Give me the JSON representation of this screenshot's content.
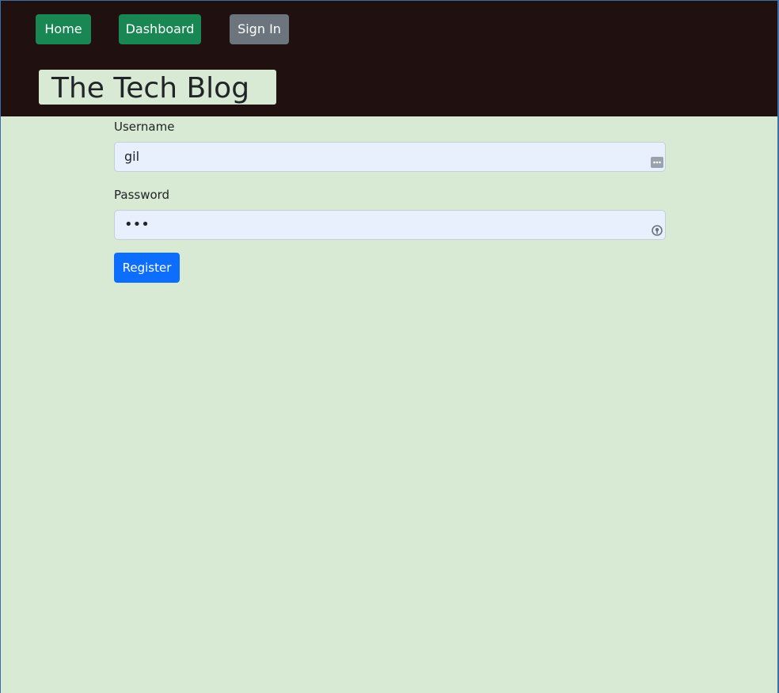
{
  "nav": {
    "home_label": "Home",
    "dashboard_label": "Dashboard",
    "signin_label": "Sign In"
  },
  "header": {
    "title": "The Tech Blog"
  },
  "form": {
    "username_label": "Username",
    "username_value": "gil",
    "password_label": "Password",
    "password_value": "•••",
    "register_label": "Register"
  },
  "icons": {
    "username_field_icon": "autofill-dots-icon",
    "password_field_icon": "password-key-icon"
  },
  "colors": {
    "header_bg": "#211010",
    "page_bg": "#d8e9d4",
    "nav_green": "#198754",
    "nav_gray": "#6c757d",
    "primary_blue": "#0d6efd",
    "input_bg": "#e8f0fe"
  }
}
